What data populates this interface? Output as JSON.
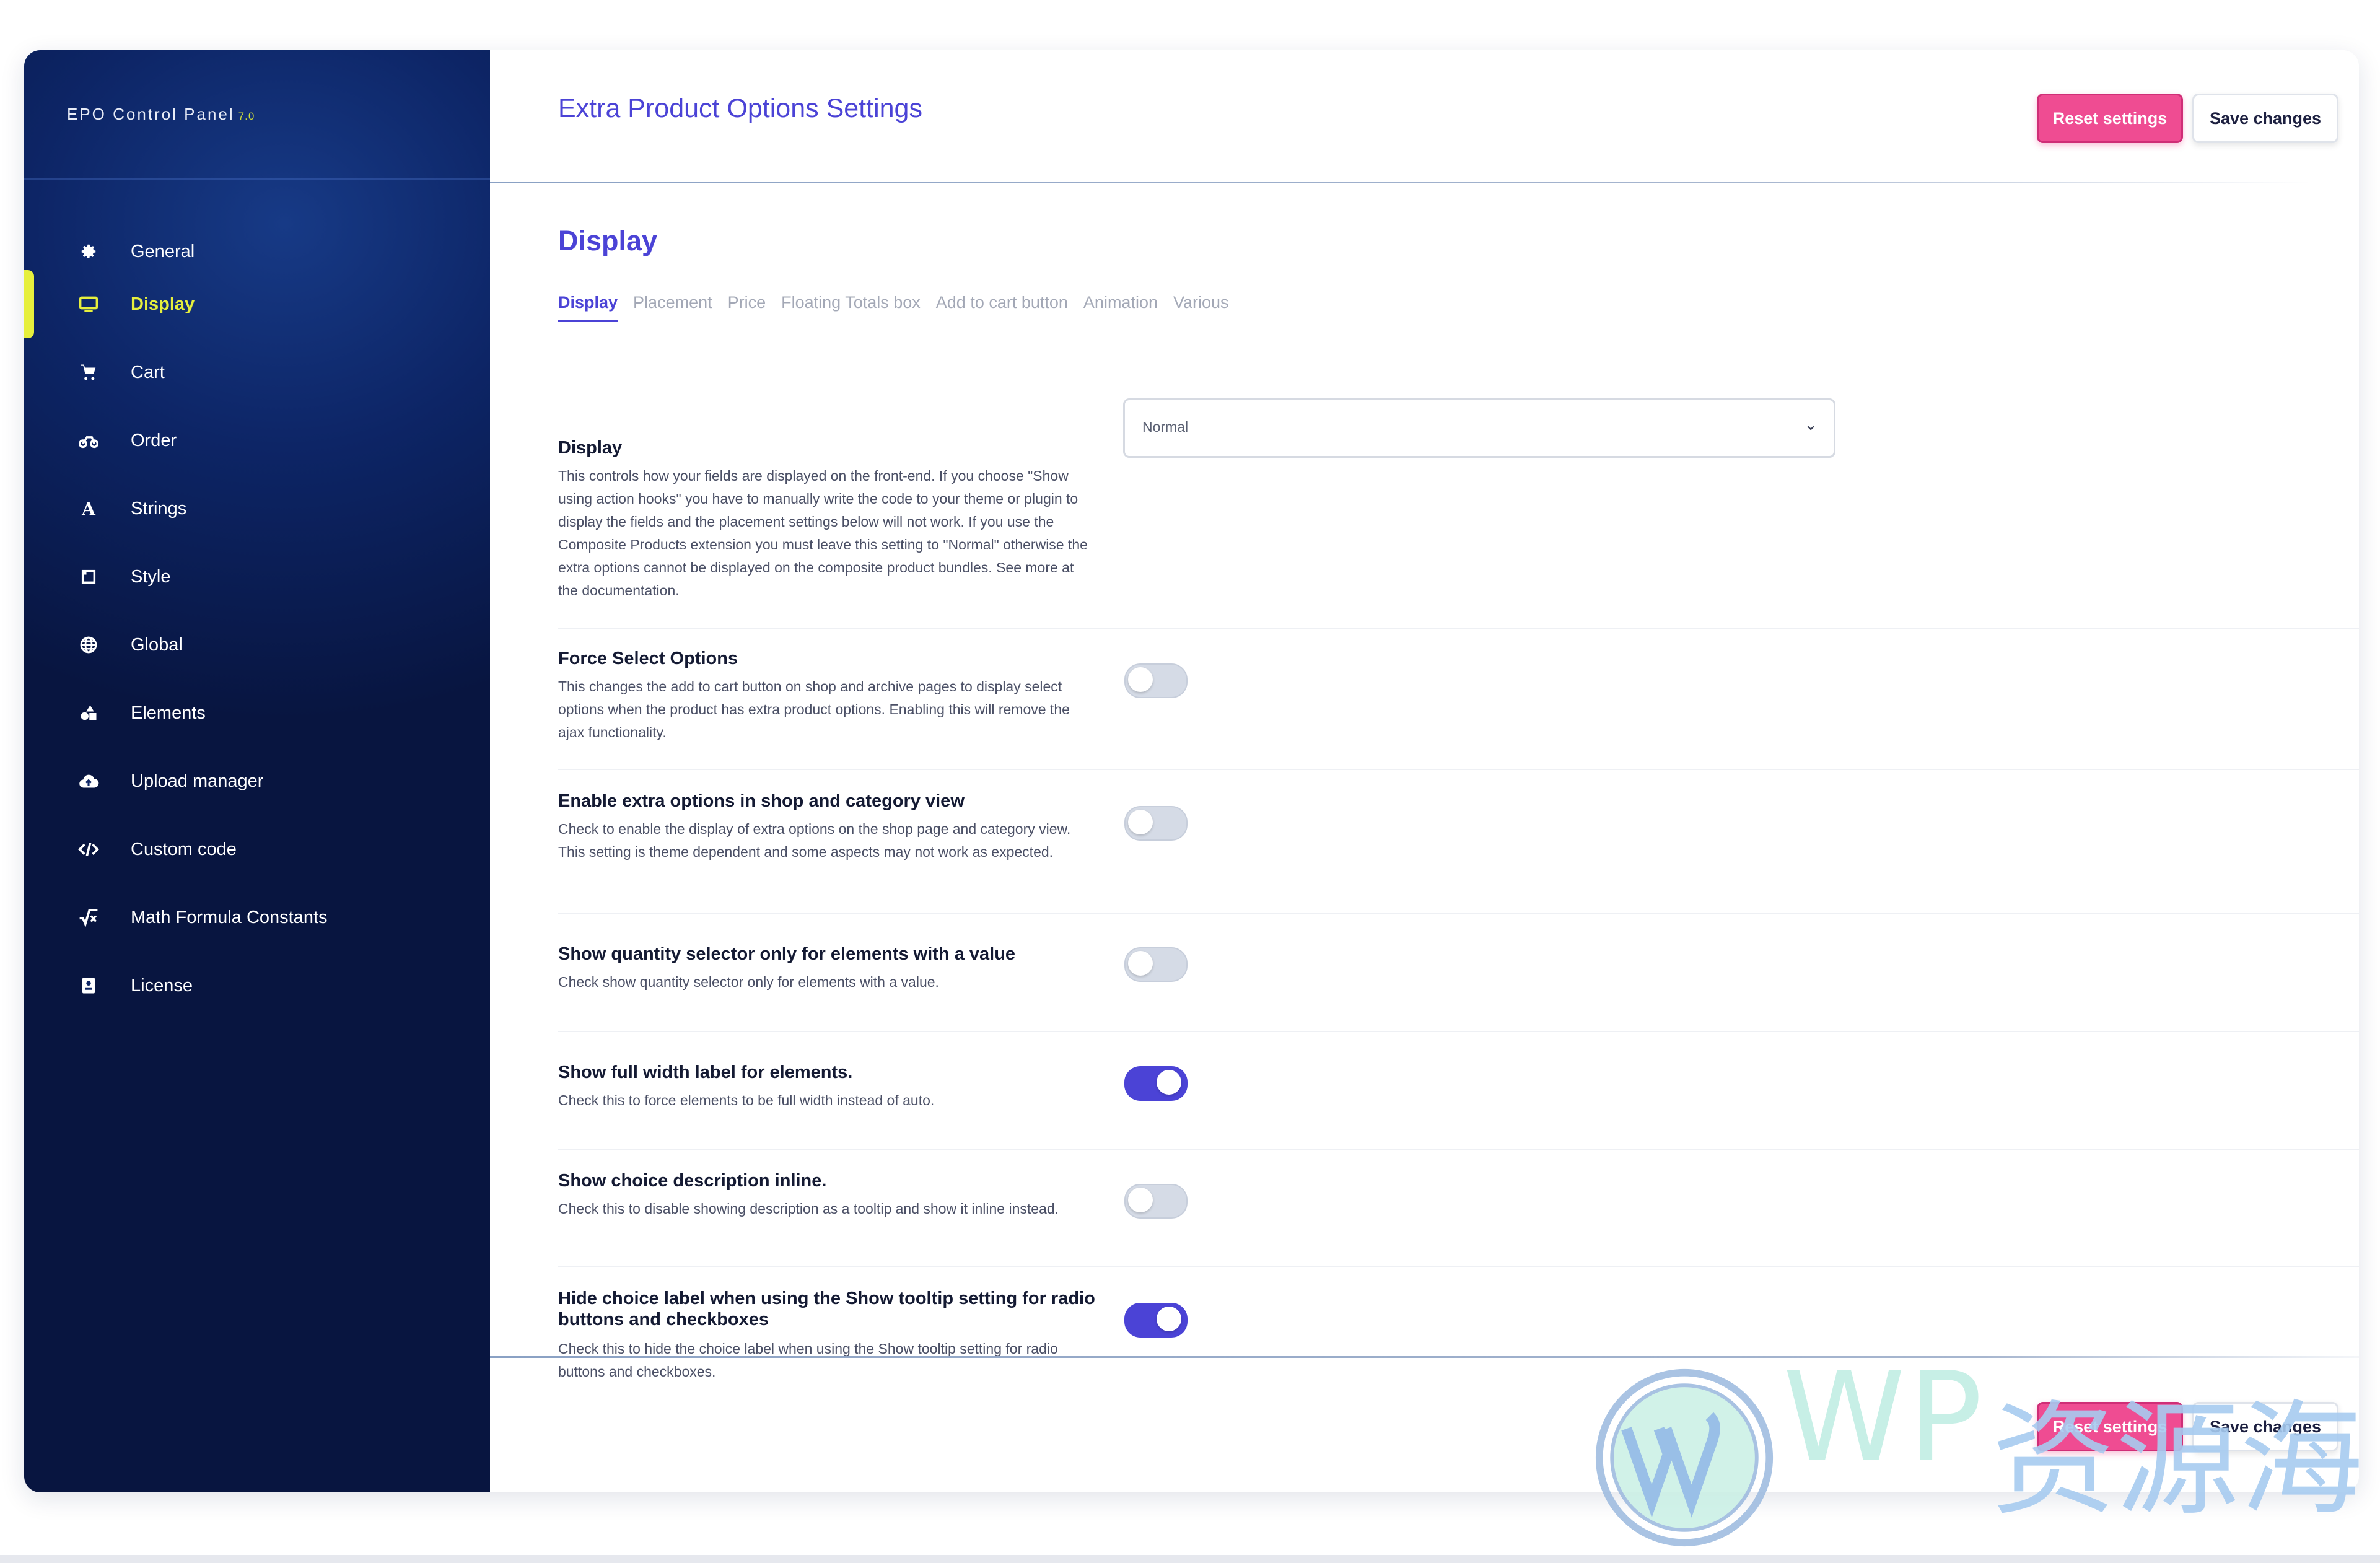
{
  "brand": {
    "name": "EPO Control Panel",
    "version": "7.0"
  },
  "sidebar": {
    "items": [
      {
        "label": "General",
        "icon": "gear-icon"
      },
      {
        "label": "Display",
        "icon": "monitor-icon",
        "active": true
      },
      {
        "label": "Cart",
        "icon": "cart-icon"
      },
      {
        "label": "Order",
        "icon": "order-icon"
      },
      {
        "label": "Strings",
        "icon": "font-icon"
      },
      {
        "label": "Style",
        "icon": "style-icon"
      },
      {
        "label": "Global",
        "icon": "globe-icon"
      },
      {
        "label": "Elements",
        "icon": "shapes-icon"
      },
      {
        "label": "Upload manager",
        "icon": "cloud-upload-icon"
      },
      {
        "label": "Custom code",
        "icon": "code-icon"
      },
      {
        "label": "Math Formula Constants",
        "icon": "square-root-icon"
      },
      {
        "label": "License",
        "icon": "license-icon"
      }
    ]
  },
  "header": {
    "title": "Extra Product Options Settings",
    "reset_label": "Reset settings",
    "save_label": "Save changes"
  },
  "section": {
    "title": "Display",
    "tabs": [
      "Display",
      "Placement",
      "Price",
      "Floating Totals box",
      "Add to cart button",
      "Animation",
      "Various"
    ],
    "active_tab": "Display"
  },
  "settings": [
    {
      "title": "Display",
      "description": "This controls how your fields are displayed on the front-end. If you choose \"Show using action hooks\" you have to manually write the code to your theme or plugin to display the fields and the placement settings below will not work. If you use the Composite Products extension you must leave this setting to \"Normal\" otherwise the extra options cannot be displayed on the composite product bundles. See more at the documentation.",
      "control": "select",
      "value": "Normal"
    },
    {
      "title": "Force Select Options",
      "description": "This changes the add to cart button on shop and archive pages to display select options when the product has extra product options. Enabling this will remove the ajax functionality.",
      "control": "toggle",
      "on": false
    },
    {
      "title": "Enable extra options in shop and category view",
      "description": "Check to enable the display of extra options on the shop page and category view. This setting is theme dependent and some aspects may not work as expected.",
      "control": "toggle",
      "on": false
    },
    {
      "title": "Show quantity selector only for elements with a value",
      "description": "Check show quantity selector only for elements with a value.",
      "control": "toggle",
      "on": false
    },
    {
      "title": "Show full width label for elements.",
      "description": "Check this to force elements to be full width instead of auto.",
      "control": "toggle",
      "on": true
    },
    {
      "title": "Show choice description inline.",
      "description": "Check this to disable showing description as a tooltip and show it inline instead.",
      "control": "toggle",
      "on": false
    },
    {
      "title": "Hide choice label when using the Show tooltip setting for radio buttons and checkboxes",
      "description": "Check this to hide the choice label when using the Show tooltip setting for radio buttons and checkboxes.",
      "control": "toggle",
      "on": true
    }
  ],
  "footer": {
    "reset_label": "Reset settings",
    "save_label": "Save changes"
  },
  "watermark": {
    "text": "WP",
    "cn": "资源海"
  },
  "colors": {
    "accent": "#4b43d6",
    "active_nav": "#e6ef3d",
    "reset_button": "#ef4c92",
    "sidebar_bg": "#0d2566"
  }
}
